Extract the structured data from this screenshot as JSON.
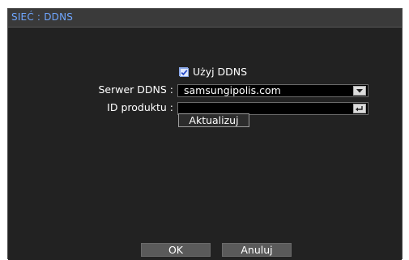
{
  "window": {
    "title": "SIEĆ : DDNS"
  },
  "ddns": {
    "use_ddns_label": "Użyj DDNS",
    "use_ddns_checked": true,
    "server_label": "Serwer DDNS :",
    "server_value": "samsungipolis.com",
    "product_id_label": "ID produktu :",
    "product_id_value": "",
    "update_label": "Aktualizuj"
  },
  "footer": {
    "ok_label": "OK",
    "cancel_label": "Anuluj"
  },
  "colors": {
    "title_text": "#6fa6ff",
    "background": "#222222",
    "titlebar": "#3a3a3a"
  },
  "icons": {
    "dropdown": "chevron-down-icon",
    "enter": "enter-icon",
    "checkbox": "check-icon"
  }
}
